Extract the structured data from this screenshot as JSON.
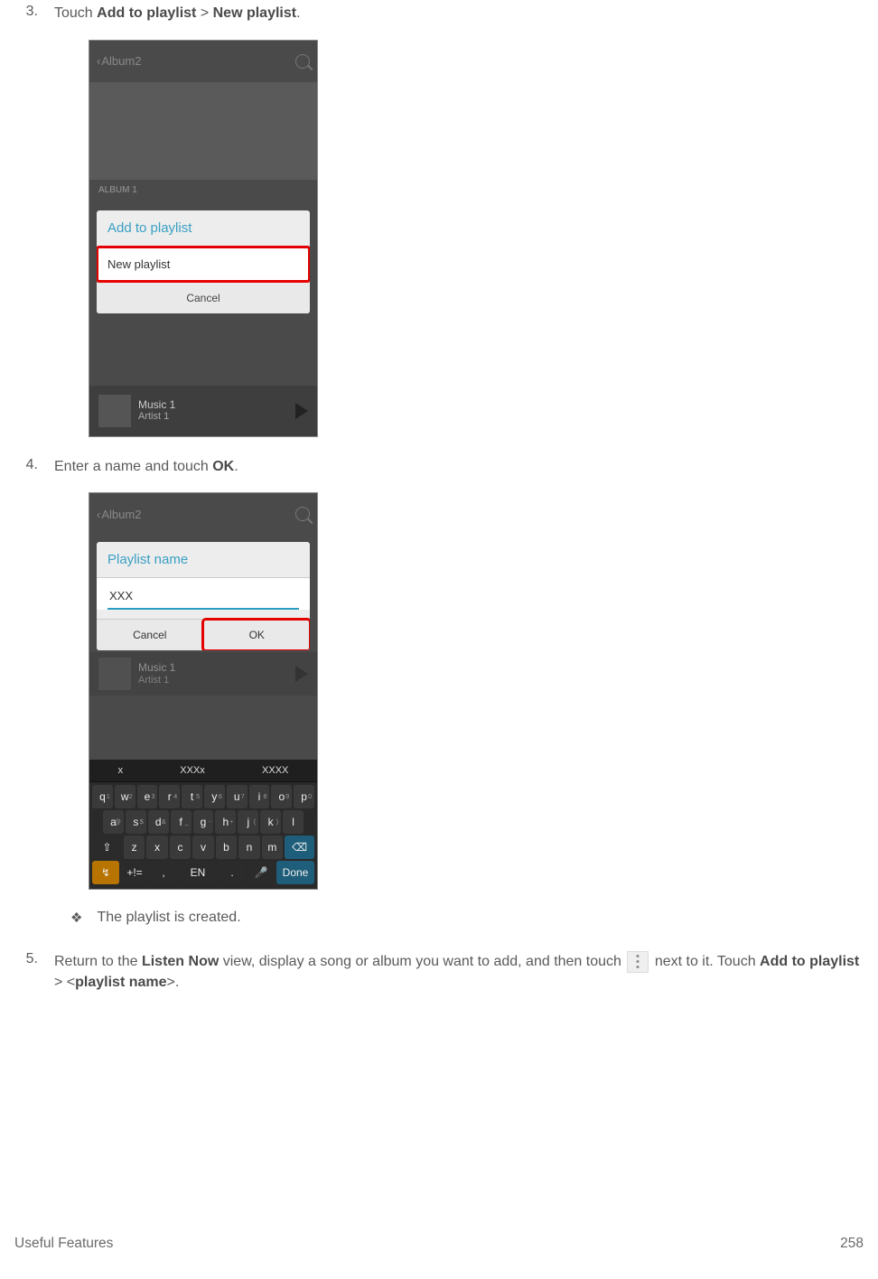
{
  "steps": {
    "s3": {
      "num": "3.",
      "prefix": "Touch ",
      "b1": "Add to playlist",
      "mid": " > ",
      "b2": "New playlist",
      "end": "."
    },
    "s4": {
      "num": "4.",
      "prefix": "Enter a name and touch ",
      "b1": "OK",
      "end": "."
    },
    "s5": {
      "num": "5.",
      "prefix": "Return to the ",
      "b1": "Listen Now",
      "mid1": " view, display a song or album you want to add, and then touch ",
      "mid2": "next to it. Touch ",
      "b2": "Add to playlist",
      "mid3": " > <",
      "b3": "playlist name",
      "end": ">."
    }
  },
  "note_text": "The playlist is created.",
  "phone1": {
    "title": "Album2",
    "album_label": "ALBUM 1",
    "dialog_title": "Add to playlist",
    "dialog_row": "New playlist",
    "dialog_cancel": "Cancel",
    "track": "Music 1",
    "artist": "Artist 1"
  },
  "phone2": {
    "title": "Album2",
    "dialog_title": "Playlist name",
    "input_value": "XXX",
    "btn_cancel": "Cancel",
    "btn_ok": "OK",
    "track": "Music 1",
    "artist": "Artist 1",
    "sug": [
      "x",
      "XXXx",
      "XXXX"
    ],
    "rows": [
      [
        "q",
        "w",
        "e",
        "r",
        "t",
        "y",
        "u",
        "i",
        "o",
        "p"
      ],
      [
        "a",
        "s",
        "d",
        "f",
        "g",
        "h",
        "j",
        "k",
        "l"
      ],
      [
        "⇧",
        "z",
        "x",
        "c",
        "v",
        "b",
        "n",
        "m",
        "⌫"
      ],
      [
        "↯",
        "+!=",
        ",",
        "EN",
        ".",
        "🎤",
        "Done"
      ]
    ],
    "subs": [
      [
        "1",
        "2",
        "3",
        "4",
        "5",
        "6",
        "7",
        "8",
        "9",
        "0"
      ],
      [
        "@",
        "$",
        "&",
        "_",
        "-",
        "+",
        "(",
        ")",
        ""
      ]
    ]
  },
  "footer": {
    "left": "Useful Features",
    "right": "258"
  }
}
